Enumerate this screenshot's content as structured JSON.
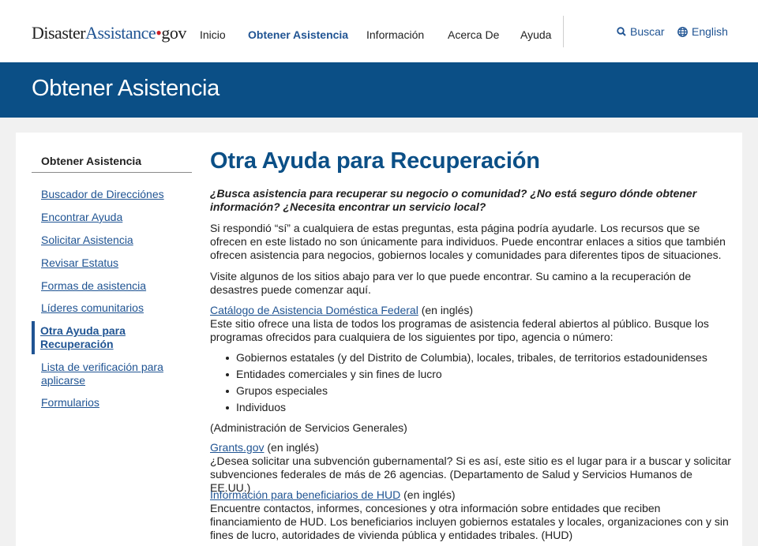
{
  "header": {
    "logo": {
      "part1": "Disaster",
      "part2": "Assistance",
      "dot": "•",
      "part3": "gov"
    },
    "nav": [
      {
        "label": "Inicio",
        "active": false
      },
      {
        "label": "Obtener Asistencia",
        "active": true
      },
      {
        "label": "Información",
        "active": false
      },
      {
        "label": "Acerca De",
        "active": false
      },
      {
        "label": "Ayuda",
        "active": false
      }
    ],
    "search_label": "Buscar",
    "language_label": "English"
  },
  "banner": {
    "title": "Obtener Asistencia"
  },
  "sidebar": {
    "title": "Obtener Asistencia",
    "items": [
      {
        "label": "Buscador de Direcciónes"
      },
      {
        "label": "Encontrar Ayuda"
      },
      {
        "label": "Solicitar Asistencia"
      },
      {
        "label": "Revisar Estatus"
      },
      {
        "label": "Formas de asistencia"
      },
      {
        "label": "Líderes comunitarios"
      },
      {
        "label_line1": "Otra Ayuda para",
        "label_line2": "Recuperación",
        "active": true
      },
      {
        "label_line1": "Lista de verificación para",
        "label_line2": "aplicarse"
      },
      {
        "label": "Formularios"
      }
    ]
  },
  "main": {
    "title": "Otra Ayuda para Recuperación",
    "lead": "¿Busca asistencia para recuperar su negocio o comunidad? ¿No está seguro dónde obtener información? ¿Necesita encontrar un servicio local?",
    "intro1": "Si respondió “sí” a cualquiera de estas preguntas, esta página podría ayudarle. Los recursos que se ofrecen en este listado no son únicamente para individuos. Puede encontrar enlaces a sitios que también ofrecen asistencia para negocios, gobiernos locales y comunidades para diferentes tipos de situaciones.",
    "intro2": "Visite algunos de los sitios abajo para ver lo que puede encontrar. Su camino a la recuperación de desastres puede comenzar aquí.",
    "resources": [
      {
        "link": "Catálogo de Asistencia Doméstica Federal",
        "lang": " (en inglés)",
        "description": "Este sitio ofrece una lista de todos los programas de asistencia federal abiertos al público. Busque los programas ofrecidos para cualquiera de los siguientes por tipo, agencia o número:",
        "bullets": [
          "Gobiernos estatales (y del Distrito de Columbia), locales, tribales, de territorios estadounidenses",
          "Entidades comerciales y sin fines de lucro",
          "Grupos especiales",
          "Individuos"
        ],
        "source": "(Administración de Servicios Generales)"
      },
      {
        "link": "Grants.gov",
        "lang": " (en inglés)",
        "description": "¿Desea solicitar una subvención gubernamental? Si es así, este sitio es el lugar para ir a buscar y solicitar subvenciones federales de más de 26 agencias. (Departamento de Salud y Servicios Humanos de EE.UU.)"
      },
      {
        "link": "Información para beneficiarios de HUD",
        "lang": " (en inglés)",
        "description": "Encuentre contactos, informes, concesiones y otra información sobre entidades que reciben financiamiento de HUD. Los beneficiarios incluyen gobiernos estatales y locales, organizaciones con y sin fines de lucro, autoridades de vivienda pública y entidades tribales. (HUD)"
      }
    ]
  },
  "colors": {
    "brand_blue": "#205493",
    "banner_blue": "#0b4f86",
    "logo_red": "#cd2026"
  },
  "icons": {
    "search": "search-icon",
    "language": "globe-icon"
  }
}
